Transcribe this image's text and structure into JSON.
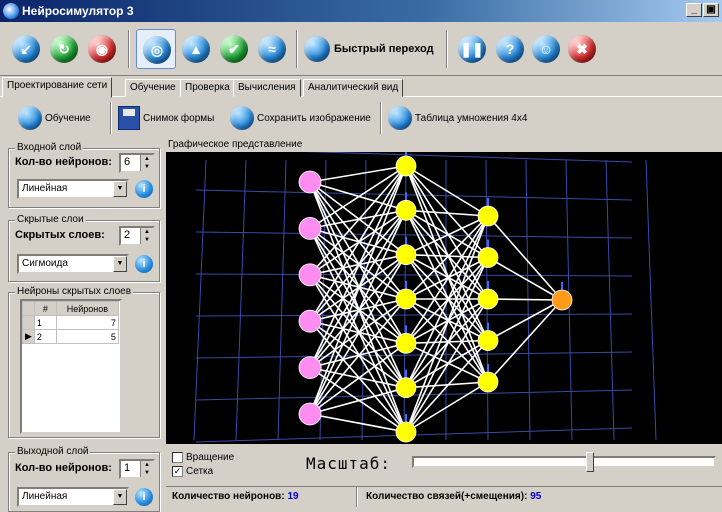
{
  "window": {
    "title": "Нейросимулятор 3",
    "controls": [
      "_",
      "▣",
      "×"
    ]
  },
  "toolbar": {
    "buttons": [
      {
        "name": "back",
        "color": "blue",
        "glyph": "↙"
      },
      {
        "name": "refresh",
        "color": "green",
        "glyph": "↻"
      },
      {
        "name": "stop",
        "color": "red",
        "glyph": "◉"
      },
      {
        "name": "view",
        "color": "blue",
        "glyph": "◎",
        "selected": true
      },
      {
        "name": "up",
        "color": "blue",
        "glyph": "▲"
      },
      {
        "name": "check",
        "color": "green",
        "glyph": "✔"
      },
      {
        "name": "wave",
        "color": "blue",
        "glyph": "≈"
      }
    ],
    "quick_label": "Быстрый переход",
    "right_buttons": [
      {
        "name": "pause",
        "color": "blue",
        "glyph": "⏸"
      },
      {
        "name": "help",
        "color": "blue",
        "glyph": "?"
      },
      {
        "name": "config",
        "color": "blue",
        "glyph": "☺"
      },
      {
        "name": "close",
        "color": "red",
        "glyph": "✖"
      }
    ]
  },
  "tabs": [
    "Проектирование сети",
    "Обучение",
    "Проверка",
    "Вычисления",
    "Аналитический вид"
  ],
  "subtoolbar": {
    "train": "Обучение",
    "snapshot": "Снимок формы",
    "save_image": "Сохранить изображение",
    "table": "Таблица умножения 4x4"
  },
  "input_layer": {
    "group": "Входной слой",
    "label": "Кол-во нейронов:",
    "count": "6",
    "activation": "Линейная"
  },
  "hidden_layers": {
    "group": "Скрытые слои",
    "label": "Скрытых слоев:",
    "count": "2",
    "activation": "Сигмоида"
  },
  "hidden_neurons": {
    "group": "Нейроны скрытых слоев",
    "col_num": "#",
    "col_neurons": "Нейронов",
    "rows": [
      {
        "n": "1",
        "v": "7"
      },
      {
        "n": "2",
        "v": "5"
      }
    ]
  },
  "output_layer": {
    "group": "Выходной слой",
    "label": "Кол-во нейронов:",
    "count": "1",
    "activation": "Линейная"
  },
  "graph": {
    "label": "Графическое представление",
    "layers": [
      6,
      7,
      5,
      1
    ],
    "colors": {
      "input": "#ff8cf0",
      "hidden": "#ffff00",
      "output": "#ff9a1a",
      "grid": "#3a4aa8"
    }
  },
  "options": {
    "rotation": "Вращение",
    "rotation_checked": false,
    "grid": "Сетка",
    "grid_checked": true
  },
  "zoom": {
    "label": "Масштаб:",
    "level": 0.58
  },
  "status": {
    "neurons_label": "Количество нейронов:",
    "neurons": "19",
    "links_label": "Количество связей(+смещения):",
    "links": "95"
  }
}
